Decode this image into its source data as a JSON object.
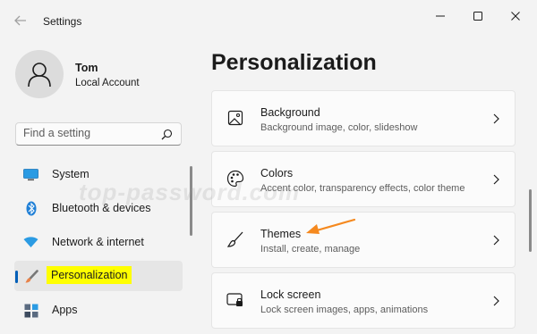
{
  "window": {
    "title": "Settings",
    "controls": {
      "minimize": "minimize-icon",
      "maximize": "maximize-icon",
      "close": "close-icon"
    }
  },
  "profile": {
    "name": "Tom",
    "account_type": "Local Account",
    "avatar_icon": "user-icon"
  },
  "search": {
    "placeholder": "Find a setting",
    "icon": "search-icon"
  },
  "nav": {
    "items": [
      {
        "label": "System",
        "icon": "monitor-icon",
        "selected": false
      },
      {
        "label": "Bluetooth & devices",
        "icon": "bluetooth-icon",
        "selected": false
      },
      {
        "label": "Network & internet",
        "icon": "wifi-icon",
        "selected": false
      },
      {
        "label": "Personalization",
        "icon": "brush-icon",
        "selected": true,
        "highlight_color": "#ffff00"
      },
      {
        "label": "Apps",
        "icon": "apps-icon",
        "selected": false
      }
    ]
  },
  "main": {
    "title": "Personalization",
    "cards": [
      {
        "title": "Background",
        "subtitle": "Background image, color, slideshow",
        "icon": "image-icon"
      },
      {
        "title": "Colors",
        "subtitle": "Accent color, transparency effects, color theme",
        "icon": "palette-icon"
      },
      {
        "title": "Themes",
        "subtitle": "Install, create, manage",
        "icon": "brush-icon"
      },
      {
        "title": "Lock screen",
        "subtitle": "Lock screen images, apps, animations",
        "icon": "lock-screen-icon"
      }
    ]
  },
  "annotation": {
    "arrow_color": "#f5891f"
  },
  "watermark": "top-password.com",
  "colors": {
    "accent": "#005fb8",
    "background": "#f3f3f3",
    "card": "#fbfbfb"
  }
}
